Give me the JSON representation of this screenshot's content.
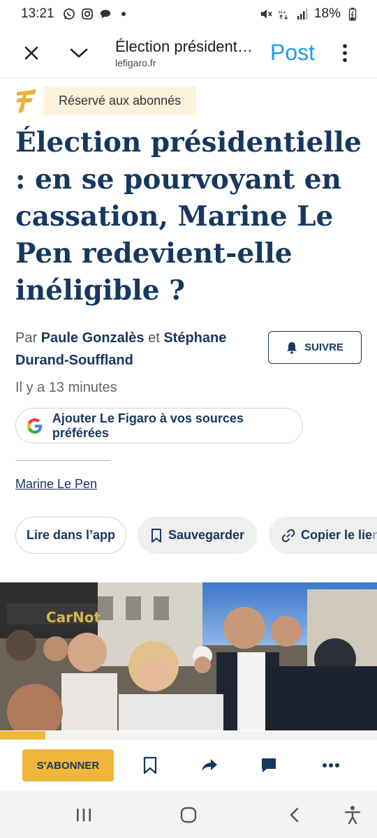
{
  "status_bar": {
    "time": "13:21",
    "battery": "18%",
    "left_icons": [
      "whatsapp-icon",
      "instagram-icon",
      "chat-icon",
      "dot-icon"
    ],
    "right_icons": [
      "mute-icon",
      "data-icon",
      "signal-icon",
      "battery-icon"
    ]
  },
  "topbar": {
    "title": "Élection présidentielle : en se pourvoyant en cassation, Marine Le Pen redevient-elle inéligible ?",
    "url": "lefigaro.fr",
    "post_label": "Post",
    "post_color": "#1d9bf0"
  },
  "article": {
    "badge": "Réservé aux abonnés",
    "headline": "Élection présidentielle : en se pourvoyant en cassation, Marine Le Pen redevient-elle inéligible ?",
    "byline_prefix": "Par",
    "author1": "Paule Gonzalès",
    "byline_join": "et",
    "author2": "Stéphane Durand-Souffland",
    "follow_label": "SUIVRE",
    "time_ago": "Il y a 13 minutes",
    "google_label": "Ajouter Le Figaro à vos sources préférées",
    "tag": "Marine Le Pen",
    "actions": {
      "read_app": "Lire dans l’app",
      "save": "Sauvegarder",
      "copy_visible": "Copier le lie",
      "copy_faded": "n"
    },
    "progress": 0.12,
    "headline_color": "#163860",
    "accent_color": "#efb83a"
  },
  "bottom_bar": {
    "subscribe_label": "S'ABONNER",
    "icons": [
      "bookmark-icon",
      "share-icon",
      "comment-icon",
      "more-icon"
    ]
  },
  "nav_bar": {
    "buttons": [
      "recents-icon",
      "home-icon",
      "back-icon",
      "accessibility-icon"
    ]
  }
}
